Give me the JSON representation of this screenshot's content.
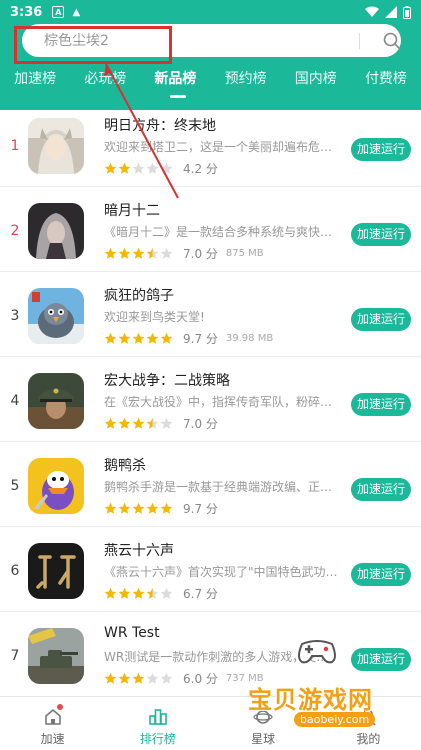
{
  "status_bar": {
    "time": "3:36",
    "icons": [
      "a-notification-icon",
      "warning-icon",
      "wifi-icon",
      "signal-icon",
      "battery-icon"
    ]
  },
  "search": {
    "placeholder": "棕色尘埃2"
  },
  "tabs": [
    {
      "label": "加速榜",
      "active": false
    },
    {
      "label": "必玩榜",
      "active": false
    },
    {
      "label": "新品榜",
      "active": true
    },
    {
      "label": "预约榜",
      "active": false
    },
    {
      "label": "国内榜",
      "active": false
    },
    {
      "label": "付费榜",
      "active": false
    }
  ],
  "apps": [
    {
      "rank": "1",
      "name": "明日方舟：终末地",
      "desc": "欢迎来到塔卫二，这是一个美丽却遍布危机...",
      "rating_value": 2,
      "rating": "4.2 分",
      "size": "",
      "button": "加速运行",
      "icon": "arknights-icon",
      "top": true
    },
    {
      "rank": "2",
      "name": "暗月十二",
      "desc": "《暗月十二》是一款结合多种系统与爽快动...",
      "rating_value": 3.5,
      "rating": "7.0 分",
      "size": "875 MB",
      "button": "加速运行",
      "icon": "dark-moon-icon",
      "top": true
    },
    {
      "rank": "3",
      "name": "疯狂的鸽子",
      "desc": "欢迎来到鸟类天堂!",
      "rating_value": 5,
      "rating": "9.7 分",
      "size": "39.98 MB",
      "button": "加速运行",
      "icon": "pigeon-icon",
      "top": false
    },
    {
      "rank": "4",
      "name": "宏大战争：二战策略",
      "desc": "在《宏大战役》中，指挥传奇军队，粉碎敌...",
      "rating_value": 3.5,
      "rating": "7.0 分",
      "size": "",
      "button": "加速运行",
      "icon": "officer-icon",
      "top": false
    },
    {
      "rank": "5",
      "name": "鹅鸭杀",
      "desc": "鹅鸭杀手游是一款基于经典端游改编、正版...",
      "rating_value": 5,
      "rating": "9.7 分",
      "size": "",
      "button": "加速运行",
      "icon": "goose-icon",
      "top": false
    },
    {
      "rank": "6",
      "name": "燕云十六声",
      "desc": "《燕云十六声》首次实现了\"中国特色武功\"...",
      "rating_value": 3.5,
      "rating": "6.7 分",
      "size": "",
      "button": "加速运行",
      "icon": "yanyun-icon",
      "top": false
    },
    {
      "rank": "7",
      "name": "WR Test",
      "desc": "WR测试是一款动作刺激的多人游戏，支持6...",
      "rating_value": 3,
      "rating": "6.0 分",
      "size": "737 MB",
      "button": "加速运行",
      "icon": "tank-icon",
      "top": false
    }
  ],
  "bottom_nav": [
    {
      "label": "加速",
      "icon": "home-icon",
      "active": false,
      "badge": true
    },
    {
      "label": "排行榜",
      "icon": "ranking-icon",
      "active": true,
      "badge": false
    },
    {
      "label": "星球",
      "icon": "planet-icon",
      "active": false,
      "badge": false
    },
    {
      "label": "我的",
      "icon": "profile-icon",
      "active": false,
      "badge": false
    }
  ],
  "watermark": {
    "text": "宝贝游戏网",
    "url": "baobeiy.com"
  },
  "colors": {
    "accent": "#1cb89a",
    "rank_top": "#e0455b",
    "star": "#f5b800",
    "annotation": "#d93030"
  }
}
